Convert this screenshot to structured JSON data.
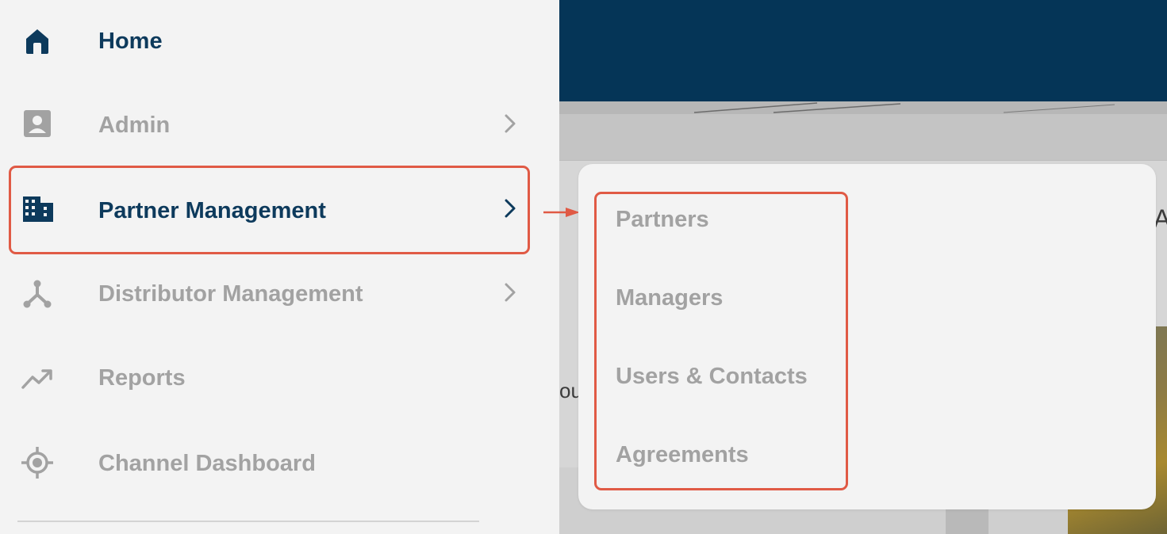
{
  "background": {
    "partial_text_left": "ou",
    "partial_text_right": "A"
  },
  "sidebar": {
    "items": [
      {
        "label": "Home",
        "icon": "home-icon",
        "state": "active",
        "has_chevron": false
      },
      {
        "label": "Admin",
        "icon": "contact-card-icon",
        "state": "muted",
        "has_chevron": true
      },
      {
        "label": "Partner Management",
        "icon": "building-icon",
        "state": "active",
        "has_chevron": true,
        "highlighted": true
      },
      {
        "label": "Distributor Management",
        "icon": "hub-network-icon",
        "state": "muted",
        "has_chevron": true
      },
      {
        "label": "Reports",
        "icon": "trending-up-icon",
        "state": "muted",
        "has_chevron": false
      },
      {
        "label": "Channel Dashboard",
        "icon": "target-icon",
        "state": "muted",
        "has_chevron": false
      }
    ]
  },
  "submenu": {
    "parent": "Partner Management",
    "items": [
      {
        "label": "Partners"
      },
      {
        "label": "Managers"
      },
      {
        "label": "Users & Contacts"
      },
      {
        "label": "Agreements"
      }
    ]
  },
  "colors": {
    "active_text": "#0d3a5c",
    "muted_text": "#a2a2a2",
    "header_navy": "#053557",
    "highlight_red": "#e05a45",
    "sidebar_bg": "#f3f3f3"
  }
}
